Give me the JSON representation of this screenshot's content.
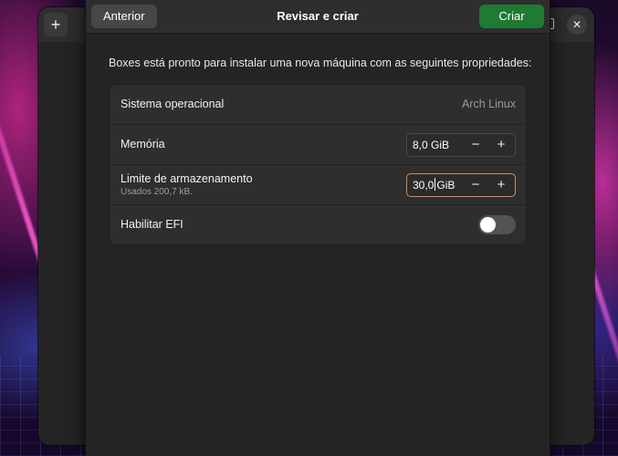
{
  "background_window": {
    "add_icon": "plus-icon",
    "close_icon": "close-icon",
    "restore_icon": "restore-icon"
  },
  "dialog": {
    "back_label": "Anterior",
    "title": "Revisar e criar",
    "create_label": "Criar",
    "description": "Boxes está pronto para instalar uma nova máquina com as seguintes propriedades:",
    "accent_color": "#1f7a34",
    "focus_color": "#d98a5c",
    "rows": [
      {
        "title": "Sistema operacional",
        "value": "Arch Linux"
      },
      {
        "title": "Memória",
        "value": "8,0 GiB",
        "minus": "−",
        "plus": "+"
      },
      {
        "title": "Limite de armazenamento",
        "subtitle": "Usados 200,7 kB.",
        "value_before_caret": "30,0",
        "value_after_caret": "GiB",
        "minus": "−",
        "plus": "+"
      },
      {
        "title": "Habilitar EFI",
        "toggle_on": false
      }
    ]
  }
}
